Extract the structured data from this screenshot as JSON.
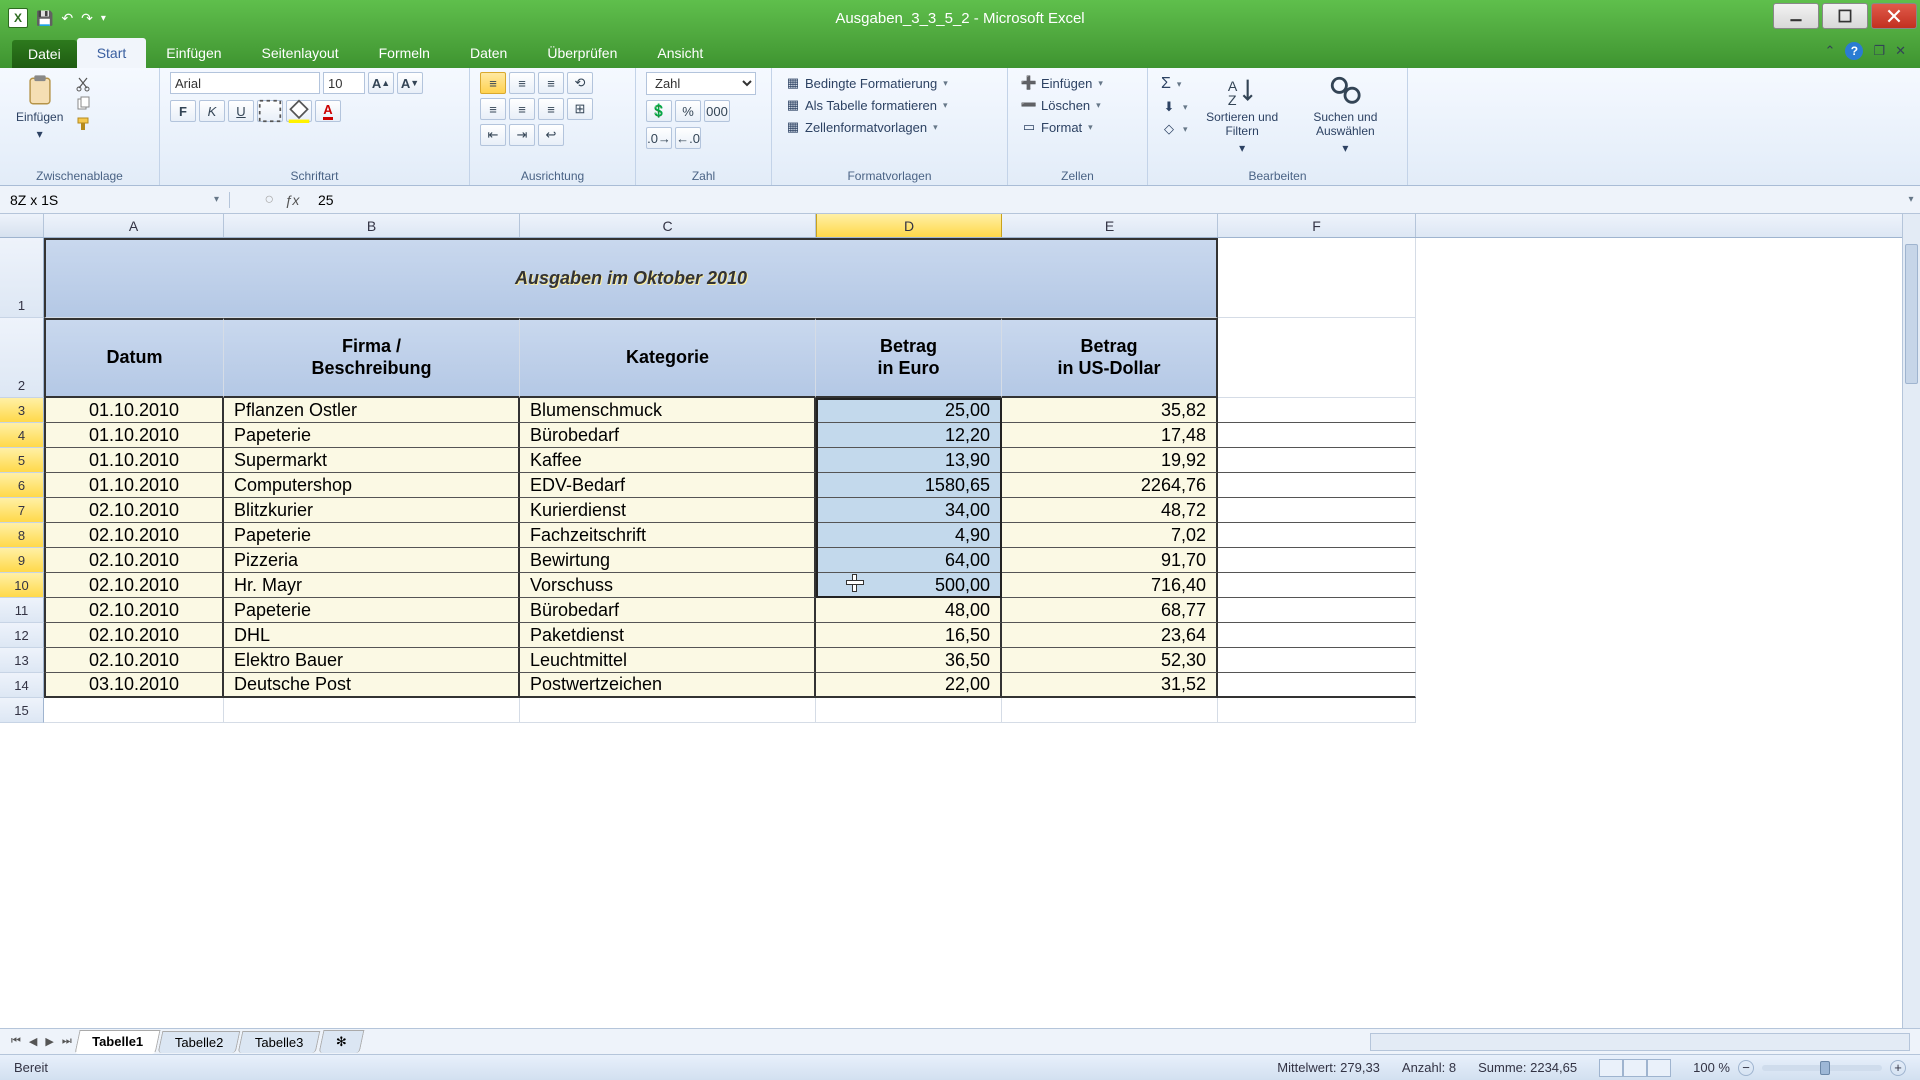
{
  "window": {
    "title": "Ausgaben_3_3_5_2 - Microsoft Excel"
  },
  "ribbon": {
    "file": "Datei",
    "tabs": [
      "Start",
      "Einfügen",
      "Seitenlayout",
      "Formeln",
      "Daten",
      "Überprüfen",
      "Ansicht"
    ],
    "active_tab": "Start",
    "groups": {
      "clipboard": {
        "label": "Zwischenablage",
        "paste": "Einfügen"
      },
      "font": {
        "label": "Schriftart",
        "name": "Arial",
        "size": "10"
      },
      "align": {
        "label": "Ausrichtung"
      },
      "number": {
        "label": "Zahl",
        "format": "Zahl"
      },
      "styles": {
        "label": "Formatvorlagen",
        "cond": "Bedingte Formatierung",
        "table": "Als Tabelle formatieren",
        "cell": "Zellenformatvorlagen"
      },
      "cells": {
        "label": "Zellen",
        "insert": "Einfügen",
        "delete": "Löschen",
        "format": "Format"
      },
      "editing": {
        "label": "Bearbeiten",
        "sort": "Sortieren und Filtern",
        "find": "Suchen und Auswählen"
      }
    }
  },
  "formula_bar": {
    "namebox": "8Z x 1S",
    "value": "25"
  },
  "columns": [
    "A",
    "B",
    "C",
    "D",
    "E",
    "F"
  ],
  "row_numbers": [
    1,
    2,
    3,
    4,
    5,
    6,
    7,
    8,
    9,
    10,
    11,
    12,
    13,
    14,
    15
  ],
  "sheet": {
    "title": "Ausgaben im Oktober 2010",
    "headers": {
      "A": "Datum",
      "B": "Firma / Beschreibung",
      "C": "Kategorie",
      "D": "Betrag in Euro",
      "E": "Betrag in US-Dollar"
    },
    "rows": [
      {
        "r": 3,
        "A": "01.10.2010",
        "B": "Pflanzen Ostler",
        "C": "Blumenschmuck",
        "D": "25,00",
        "E": "35,82"
      },
      {
        "r": 4,
        "A": "01.10.2010",
        "B": "Papeterie",
        "C": "Bürobedarf",
        "D": "12,20",
        "E": "17,48"
      },
      {
        "r": 5,
        "A": "01.10.2010",
        "B": "Supermarkt",
        "C": "Kaffee",
        "D": "13,90",
        "E": "19,92"
      },
      {
        "r": 6,
        "A": "01.10.2010",
        "B": "Computershop",
        "C": "EDV-Bedarf",
        "D": "1580,65",
        "E": "2264,76"
      },
      {
        "r": 7,
        "A": "02.10.2010",
        "B": "Blitzkurier",
        "C": "Kurierdienst",
        "D": "34,00",
        "E": "48,72"
      },
      {
        "r": 8,
        "A": "02.10.2010",
        "B": "Papeterie",
        "C": "Fachzeitschrift",
        "D": "4,90",
        "E": "7,02"
      },
      {
        "r": 9,
        "A": "02.10.2010",
        "B": "Pizzeria",
        "C": "Bewirtung",
        "D": "64,00",
        "E": "91,70"
      },
      {
        "r": 10,
        "A": "02.10.2010",
        "B": "Hr. Mayr",
        "C": "Vorschuss",
        "D": "500,00",
        "E": "716,40"
      },
      {
        "r": 11,
        "A": "02.10.2010",
        "B": "Papeterie",
        "C": "Bürobedarf",
        "D": "48,00",
        "E": "68,77"
      },
      {
        "r": 12,
        "A": "02.10.2010",
        "B": "DHL",
        "C": "Paketdienst",
        "D": "16,50",
        "E": "23,64"
      },
      {
        "r": 13,
        "A": "02.10.2010",
        "B": "Elektro Bauer",
        "C": "Leuchtmittel",
        "D": "36,50",
        "E": "52,30"
      },
      {
        "r": 14,
        "A": "03.10.2010",
        "B": "Deutsche Post",
        "C": "Postwertzeichen",
        "D": "22,00",
        "E": "31,52"
      }
    ]
  },
  "selection": {
    "range": "D3:D10"
  },
  "sheets": [
    "Tabelle1",
    "Tabelle2",
    "Tabelle3"
  ],
  "status": {
    "ready": "Bereit",
    "avg": "Mittelwert: 279,33",
    "count": "Anzahl: 8",
    "sum": "Summe: 2234,65",
    "zoom": "100 %"
  }
}
